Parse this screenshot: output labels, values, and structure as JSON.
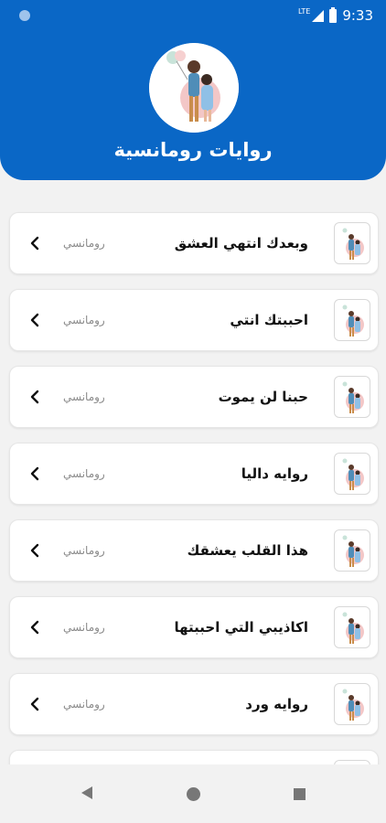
{
  "status_bar": {
    "time": "9:33",
    "network": "LTE",
    "icons": [
      "notification-dot-icon",
      "signal-icon",
      "battery-icon"
    ]
  },
  "header": {
    "title": "روايات رومانسية",
    "avatar_icon": "couple-illustration-icon"
  },
  "stories": [
    {
      "title": "وبعدك انتهي العشق",
      "category": "رومانسي"
    },
    {
      "title": "احببتك انتي",
      "category": "رومانسي"
    },
    {
      "title": "حبنا لن يموت",
      "category": "رومانسي"
    },
    {
      "title": "روايه داليا",
      "category": "رومانسي"
    },
    {
      "title": "هذا القلب يعشقك",
      "category": "رومانسي"
    },
    {
      "title": "اكاذيبي التي احببتها",
      "category": "رومانسي"
    },
    {
      "title": "روايه ورد",
      "category": "رومانسي"
    },
    {
      "title": "",
      "category": ""
    }
  ],
  "nav": {
    "icons": [
      "back-icon",
      "home-icon",
      "recents-icon"
    ]
  },
  "colors": {
    "header": "#0a67c6",
    "background": "#f2f2f2",
    "card": "#ffffff",
    "title_text": "#111111",
    "category_text": "#8a8a8a"
  }
}
